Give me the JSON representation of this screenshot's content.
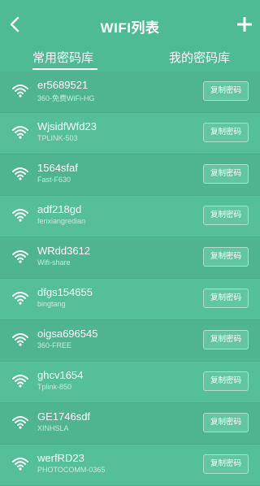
{
  "header": {
    "title": "WIFI列表"
  },
  "tabs": [
    {
      "label": "常用密码库"
    },
    {
      "label": "我的密码库"
    }
  ],
  "items": [
    {
      "name": "er5689521",
      "sub": "360-免费WiFi-HG",
      "btn": "复制密码"
    },
    {
      "name": "WjsidfWfd23",
      "sub": "TPLINK-503",
      "btn": "复制密码"
    },
    {
      "name": "1564sfaf",
      "sub": "Fast-F630",
      "btn": "复制密码"
    },
    {
      "name": "adf218gd",
      "sub": "fenxiangredian",
      "btn": "复制密码"
    },
    {
      "name": "WRdd3612",
      "sub": "Wifi-share",
      "btn": "复制密码"
    },
    {
      "name": "dfgs154655",
      "sub": "bingtang",
      "btn": "复制密码"
    },
    {
      "name": "oigsa696545",
      "sub": "360-FREE",
      "btn": "复制密码"
    },
    {
      "name": "ghcv1654",
      "sub": "Tplink-850",
      "btn": "复制密码"
    },
    {
      "name": "GE1746sdf",
      "sub": "XINHSLA",
      "btn": "复制密码"
    },
    {
      "name": "werfRD23",
      "sub": "PHOTOCOMM-0365",
      "btn": "复制密码"
    }
  ]
}
